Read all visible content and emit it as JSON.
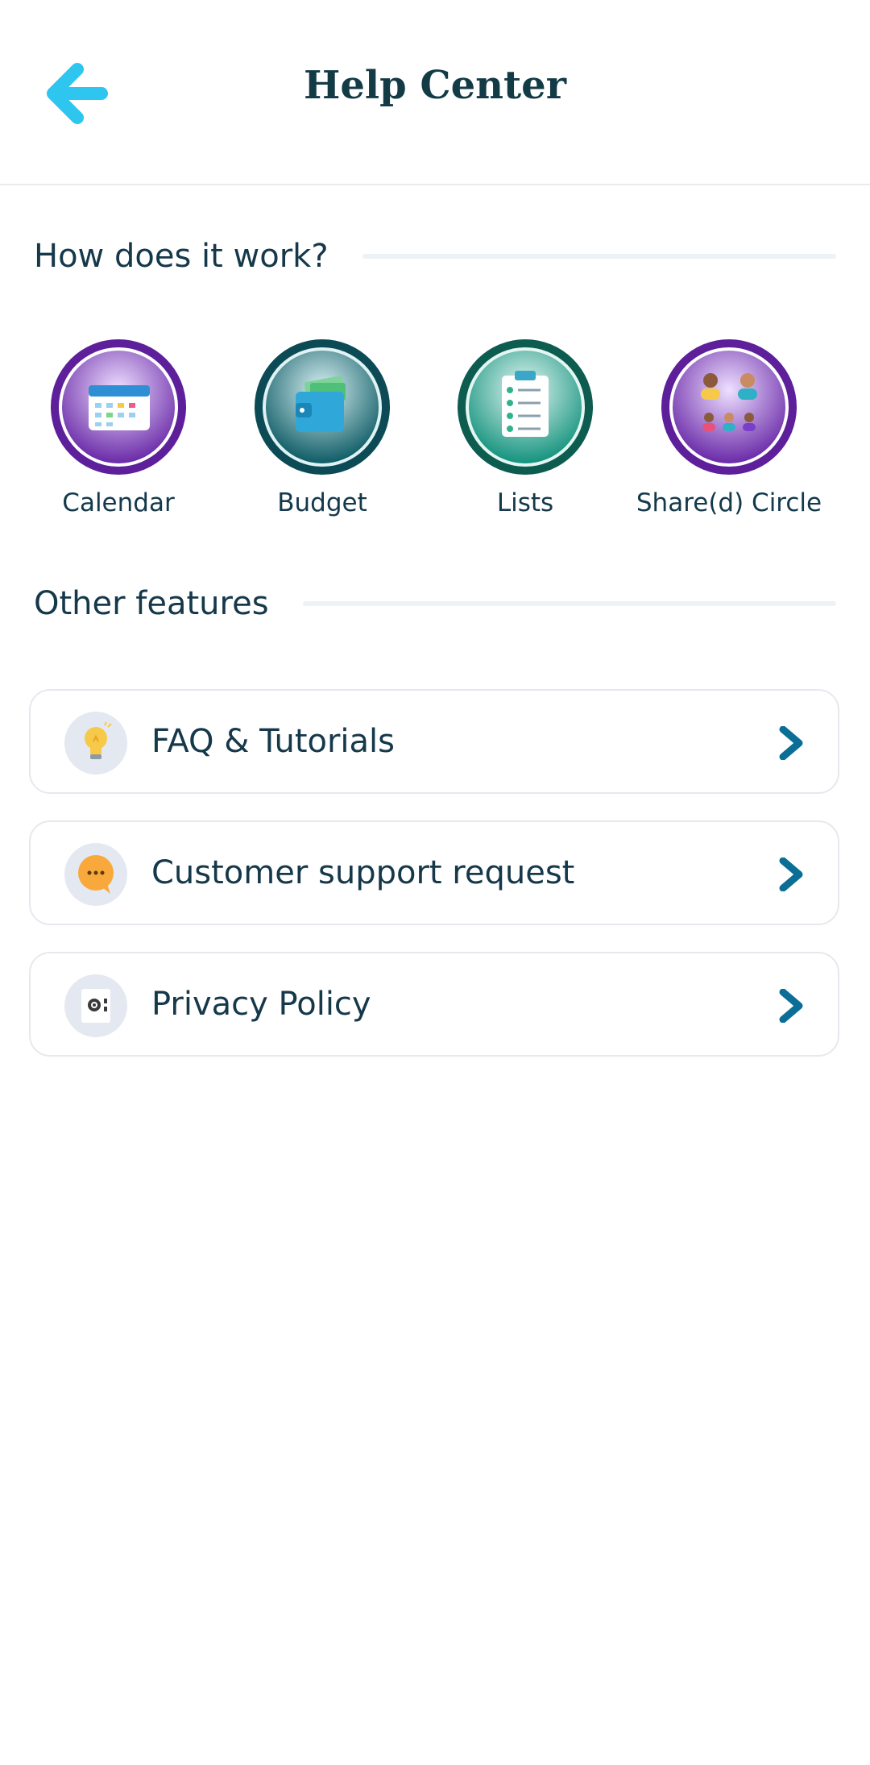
{
  "header": {
    "title": "Help Center",
    "back_icon": "arrow-left-icon"
  },
  "sections": {
    "how": "How does it work?",
    "other": "Other features"
  },
  "categories": [
    {
      "label": "Calendar",
      "icon": "calendar-icon",
      "color": "#7a2fc4"
    },
    {
      "label": "Budget",
      "icon": "wallet-icon",
      "color": "#0d5f6a"
    },
    {
      "label": "Lists",
      "icon": "clipboard-icon",
      "color": "#0f9a86"
    },
    {
      "label": "Share(d) Circle",
      "icon": "people-icon",
      "color": "#7a2fc4"
    }
  ],
  "features": [
    {
      "label": "FAQ & Tutorials",
      "icon": "lightbulb-icon"
    },
    {
      "label": "Customer support request",
      "icon": "chat-bubble-icon"
    },
    {
      "label": "Privacy Policy",
      "icon": "privacy-document-icon"
    }
  ],
  "colors": {
    "accent": "#2ec5ef",
    "chevron": "#0b6e96",
    "text": "#15384a"
  }
}
